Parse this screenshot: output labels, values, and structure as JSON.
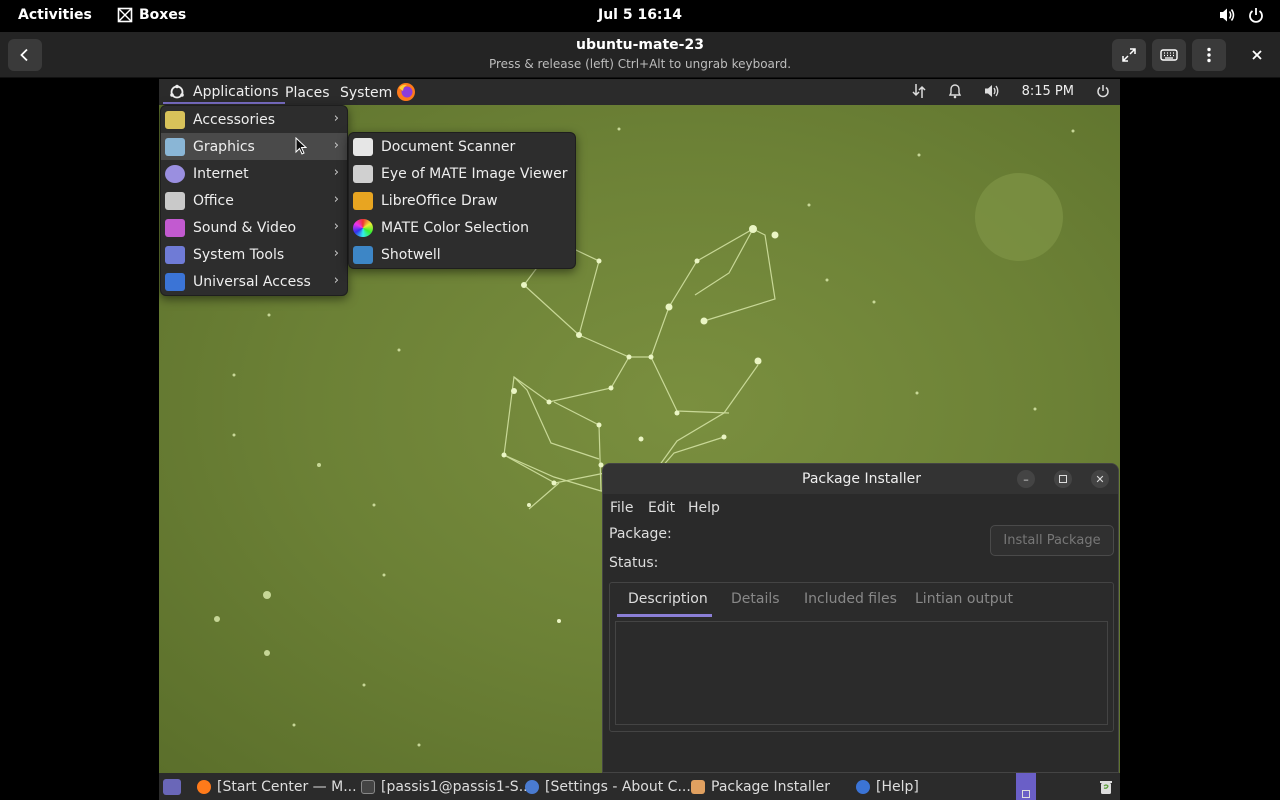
{
  "gnome_bar": {
    "activities": "Activities",
    "app_name": "Boxes",
    "clock": "Jul 5  16:14"
  },
  "boxes_header": {
    "title": "ubuntu-mate-23",
    "subtitle": "Press & release (left) Ctrl+Alt to ungrab keyboard."
  },
  "mate_panel": {
    "applications": "Applications",
    "places": "Places",
    "system": "System",
    "time": "8:15 PM"
  },
  "app_menu": {
    "items": [
      {
        "label": "Accessories",
        "color": "#d8c25a"
      },
      {
        "label": "Graphics",
        "color": "#8ab6d6"
      },
      {
        "label": "Internet",
        "color": "#9a8fe0"
      },
      {
        "label": "Office",
        "color": "#c9c9c9"
      },
      {
        "label": "Sound & Video",
        "color": "#c25ad0"
      },
      {
        "label": "System Tools",
        "color": "#6f7bd6"
      },
      {
        "label": "Universal Access",
        "color": "#3b74d6"
      }
    ]
  },
  "graphics_submenu": {
    "items": [
      {
        "label": "Document Scanner",
        "color": "#e6e6e6"
      },
      {
        "label": "Eye of MATE Image Viewer",
        "color": "#d0d0d0"
      },
      {
        "label": "LibreOffice Draw",
        "color": "#e8a521"
      },
      {
        "label": "MATE Color Selection",
        "color": "#4fb3d9"
      },
      {
        "label": "Shotwell",
        "color": "#3d86c6"
      }
    ]
  },
  "package_installer": {
    "title": "Package Installer",
    "menu_file": "File",
    "menu_edit": "Edit",
    "menu_help": "Help",
    "package_label": "Package:",
    "status_label": "Status:",
    "install_button": "Install Package",
    "tabs": [
      "Description",
      "Details",
      "Included files",
      "Lintian output"
    ]
  },
  "taskbar": {
    "items": [
      "[Start Center — M...",
      "[passis1@passis1-S...",
      "[Settings - About C...",
      "Package Installer",
      "[Help]"
    ]
  }
}
